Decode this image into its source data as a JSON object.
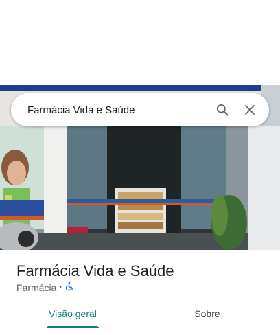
{
  "search": {
    "query": "Farmácia Vida e Saúde"
  },
  "place": {
    "title": "Farmácia Vida e Saúde",
    "category": "Farmácia",
    "separator": "•"
  },
  "tabs": [
    {
      "label": "Visão geral",
      "active": true
    },
    {
      "label": "Sobre",
      "active": false
    }
  ],
  "colors": {
    "accent": "#137a7f",
    "accessibility": "#1a73e8"
  },
  "icons": {
    "search": "search-icon",
    "close": "close-icon",
    "accessibility": "wheelchair-icon"
  }
}
